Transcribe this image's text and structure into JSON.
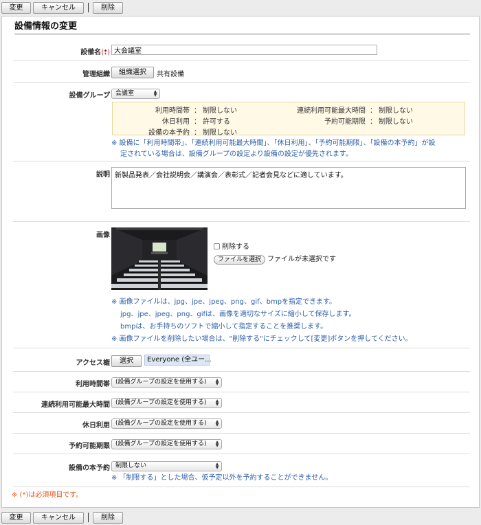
{
  "toolbar": {
    "change_label": "変更",
    "cancel_label": "キャンセル",
    "delete_label": "削除"
  },
  "form": {
    "title": "設備情報の変更",
    "colon": "：",
    "required_mark": "(*)",
    "required_note": "※ (*)は必須項目です。",
    "facility_name": {
      "label": "設備名",
      "value": "大会議室"
    },
    "management_org": {
      "label": "管理組織",
      "button_label": "組織選択",
      "value": "共有設備"
    },
    "facility_group": {
      "label": "設備グループ",
      "selected": "会議室",
      "details": {
        "usage_hours": {
          "label": "利用時間帯",
          "value": "制限しない"
        },
        "max_consecutive": {
          "label": "連続利用可能最大時間",
          "value": "制限しない"
        },
        "holiday_use": {
          "label": "休日利用",
          "value": "許可する"
        },
        "reservable_period": {
          "label": "予約可能期限",
          "value": "制限しない"
        },
        "main_reservation": {
          "label": "設備の本予約",
          "value": "制限しない"
        }
      },
      "note_line1": "※ 設備に「利用時間帯」、「連続利用可能最大時間」、「休日利用」、「予約可能期限」、「設備の本予約」が設",
      "note_line2": "定されている場合は、設備グループの設定より設備の設定が優先されます。"
    },
    "description": {
      "label": "説明",
      "value": "新製品発表／会社説明会／講演会／表彰式／記者会見などに適しています。"
    },
    "image": {
      "label": "画像",
      "delete_checkbox_label": "削除する",
      "file_button_label": "ファイルを選択",
      "file_status": "ファイルが未選択です",
      "note_line1": "※ 画像ファイルは、jpg、jpe、jpeg、png、gif、bmpを指定できます。",
      "note_line2": "jpg、jpe、jpeg、png、gifは、画像を適切なサイズに縮小して保存します。",
      "note_line3": "bmpは、お手持ちのソフトで縮小して指定することを推奨します。",
      "note_line4": "※ 画像ファイルを削除したい場合は、\"削除する\"にチェックして[変更]ボタンを押してください。"
    },
    "access": {
      "label": "アクセス権",
      "button_label": "選択",
      "value": "Everyone (全ユー..."
    },
    "usage_hours": {
      "label": "利用時間帯",
      "selected": "(設備グループの設定を使用する)"
    },
    "max_consecutive": {
      "label": "連続利用可能最大時間",
      "selected": "(設備グループの設定を使用する)"
    },
    "holiday_use": {
      "label": "休日利用",
      "selected": "(設備グループの設定を使用する)"
    },
    "reservable_period": {
      "label": "予約可能期限",
      "selected": "(設備グループの設定を使用する)"
    },
    "main_reservation": {
      "label": "設備の本予約",
      "selected": "制限しない",
      "note": "※ 「制限する」とした場合、仮予定以外を予約することができません。"
    }
  },
  "colors": {
    "note_blue": "#2d5fa8",
    "required_red": "#d22222",
    "group_box_bg": "#fff9e6"
  }
}
